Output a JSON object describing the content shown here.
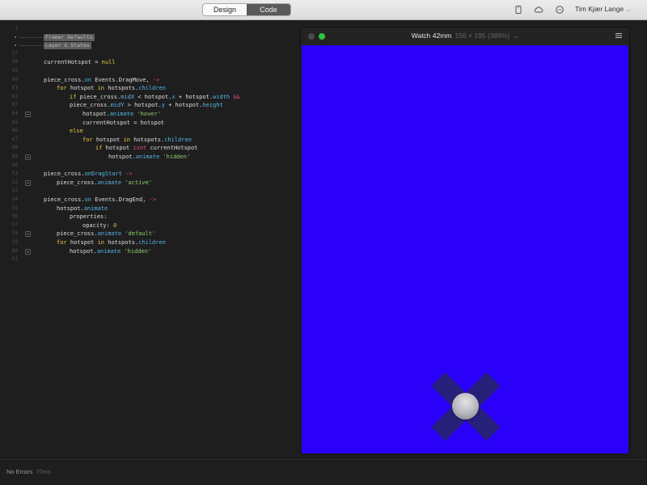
{
  "toolbar": {
    "tabs": [
      "Design",
      "Code"
    ],
    "active_tab": "Code",
    "icons": [
      "device-icon",
      "cloud-icon",
      "chat-icon"
    ],
    "user_name": "Tim Kjær Lange"
  },
  "editor": {
    "lines": [
      {
        "n": "1",
        "parts": []
      },
      {
        "n": "",
        "fold_tag": "Framer Defaults",
        "parts": []
      },
      {
        "n": "",
        "fold_tag": "Layer & States",
        "parts": []
      },
      {
        "n": "57",
        "parts": []
      },
      {
        "n": "58",
        "parts": [
          {
            "t": "currentHotspot = "
          },
          {
            "t": "null",
            "c": "kw"
          }
        ]
      },
      {
        "n": "59",
        "parts": []
      },
      {
        "n": "60",
        "parts": [
          {
            "t": "piece_cross."
          },
          {
            "t": "on",
            "c": "prop"
          },
          {
            "t": " Events.DragMove, "
          },
          {
            "t": "->",
            "c": "op"
          }
        ]
      },
      {
        "n": "61",
        "indent": 1,
        "parts": [
          {
            "t": "for",
            "c": "kw"
          },
          {
            "t": " hotspot "
          },
          {
            "t": "in",
            "c": "kw"
          },
          {
            "t": " hotspots."
          },
          {
            "t": "children",
            "c": "prop"
          }
        ]
      },
      {
        "n": "62",
        "indent": 2,
        "parts": [
          {
            "t": "if",
            "c": "kw"
          },
          {
            "t": " piece_cross."
          },
          {
            "t": "midX",
            "c": "prop"
          },
          {
            "t": " < hotspot."
          },
          {
            "t": "x",
            "c": "prop"
          },
          {
            "t": " + hotspot."
          },
          {
            "t": "width",
            "c": "prop"
          },
          {
            "t": " "
          },
          {
            "t": "&&",
            "c": "op"
          }
        ]
      },
      {
        "n": "63",
        "indent": 2,
        "parts": [
          {
            "t": "piece_cross."
          },
          {
            "t": "midY",
            "c": "prop"
          },
          {
            "t": " > hotspot."
          },
          {
            "t": "y",
            "c": "prop"
          },
          {
            "t": " + hotspot."
          },
          {
            "t": "height",
            "c": "prop"
          }
        ]
      },
      {
        "n": "64",
        "indent": 3,
        "fold": true,
        "parts": [
          {
            "t": "hotspot."
          },
          {
            "t": "animate",
            "c": "prop"
          },
          {
            "t": " "
          },
          {
            "t": "'hover'",
            "c": "str"
          }
        ]
      },
      {
        "n": "65",
        "indent": 3,
        "parts": [
          {
            "t": "currentHotspot = hotspot"
          }
        ]
      },
      {
        "n": "66",
        "indent": 2,
        "parts": [
          {
            "t": "else",
            "c": "kw"
          }
        ]
      },
      {
        "n": "67",
        "indent": 3,
        "parts": [
          {
            "t": "for",
            "c": "kw"
          },
          {
            "t": " hotspot "
          },
          {
            "t": "in",
            "c": "kw"
          },
          {
            "t": " hotspots."
          },
          {
            "t": "children",
            "c": "prop"
          }
        ]
      },
      {
        "n": "68",
        "indent": 4,
        "parts": [
          {
            "t": "if",
            "c": "kw"
          },
          {
            "t": " hotspot "
          },
          {
            "t": "isnt",
            "c": "op"
          },
          {
            "t": " currentHotspot"
          }
        ]
      },
      {
        "n": "69",
        "indent": 5,
        "fold": true,
        "parts": [
          {
            "t": "hotspot."
          },
          {
            "t": "animate",
            "c": "prop"
          },
          {
            "t": " "
          },
          {
            "t": "'hidden'",
            "c": "str"
          }
        ]
      },
      {
        "n": "50",
        "parts": []
      },
      {
        "n": "51",
        "parts": [
          {
            "t": "piece_cross."
          },
          {
            "t": "onDragStart",
            "c": "prop"
          },
          {
            "t": " "
          },
          {
            "t": "->",
            "c": "op"
          }
        ]
      },
      {
        "n": "52",
        "indent": 1,
        "fold": true,
        "parts": [
          {
            "t": "piece_cross."
          },
          {
            "t": "animate",
            "c": "prop"
          },
          {
            "t": " "
          },
          {
            "t": "'active'",
            "c": "str"
          }
        ]
      },
      {
        "n": "53",
        "parts": []
      },
      {
        "n": "54",
        "parts": [
          {
            "t": "piece_cross."
          },
          {
            "t": "on",
            "c": "prop"
          },
          {
            "t": " Events.DragEnd, "
          },
          {
            "t": "->",
            "c": "op"
          }
        ]
      },
      {
        "n": "55",
        "indent": 1,
        "parts": [
          {
            "t": "hotspot."
          },
          {
            "t": "animate",
            "c": "prop"
          }
        ]
      },
      {
        "n": "56",
        "indent": 2,
        "parts": [
          {
            "t": "properties:"
          }
        ]
      },
      {
        "n": "57",
        "indent": 3,
        "parts": [
          {
            "t": "opacity: "
          },
          {
            "t": "0",
            "c": "num"
          }
        ]
      },
      {
        "n": "58",
        "indent": 1,
        "fold": true,
        "parts": [
          {
            "t": "piece_cross."
          },
          {
            "t": "animate",
            "c": "prop"
          },
          {
            "t": " "
          },
          {
            "t": "'default'",
            "c": "str"
          }
        ]
      },
      {
        "n": "59",
        "indent": 1,
        "parts": [
          {
            "t": "for",
            "c": "kw"
          },
          {
            "t": " hotspot "
          },
          {
            "t": "in",
            "c": "kw"
          },
          {
            "t": " hotspots."
          },
          {
            "t": "children",
            "c": "prop"
          }
        ]
      },
      {
        "n": "60",
        "indent": 2,
        "fold": true,
        "parts": [
          {
            "t": "hotspot."
          },
          {
            "t": "animate",
            "c": "prop"
          },
          {
            "t": " "
          },
          {
            "t": "'hidden'",
            "c": "str"
          }
        ]
      },
      {
        "n": "61",
        "parts": []
      }
    ]
  },
  "status": {
    "text": "No Errors",
    "time": "70ms"
  },
  "preview": {
    "device": "Watch 42mm",
    "info": "156 × 195 (389%)",
    "canvas_color": "#2a00f8",
    "shape_color": "#26207a"
  },
  "colors": {
    "keyword": "#f2c94c",
    "property": "#56b6e8",
    "string": "#8fd16a",
    "operator": "#e04c8a"
  }
}
